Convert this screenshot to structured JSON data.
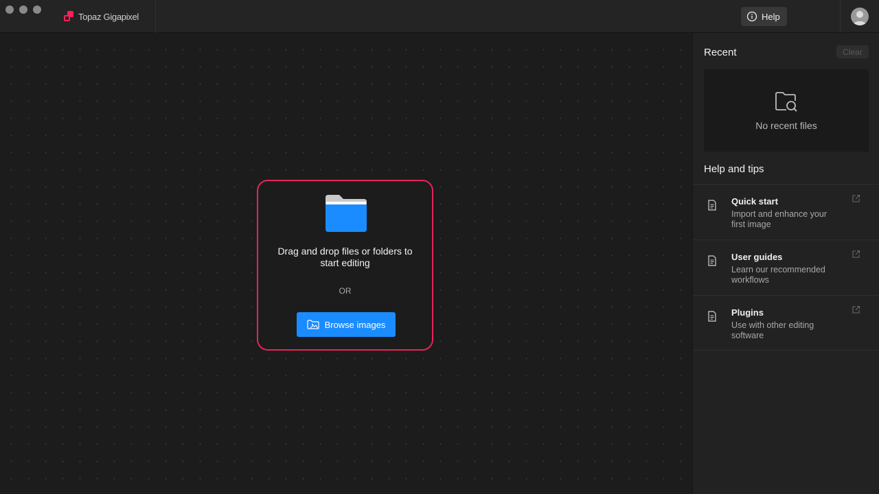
{
  "app": {
    "name": "Topaz Gigapixel"
  },
  "header": {
    "help_label": "Help"
  },
  "dropzone": {
    "instruction": "Drag and drop files or folders to start editing",
    "or_label": "OR",
    "browse_label": "Browse images"
  },
  "recent": {
    "title": "Recent",
    "clear_label": "Clear",
    "empty_message": "No recent files"
  },
  "help_tips": {
    "title": "Help and tips",
    "items": [
      {
        "title": "Quick start",
        "description": "Import and enhance your first image",
        "icon": "document-icon"
      },
      {
        "title": "User guides",
        "description": "Learn our recommended workflows",
        "icon": "document-icon"
      },
      {
        "title": "Plugins",
        "description": "Use with other editing software",
        "icon": "document-icon"
      }
    ]
  },
  "colors": {
    "accent_blue": "#1a8cff",
    "dropzone_border": "#e8245a",
    "brand_pink": "#ff1f5a"
  }
}
